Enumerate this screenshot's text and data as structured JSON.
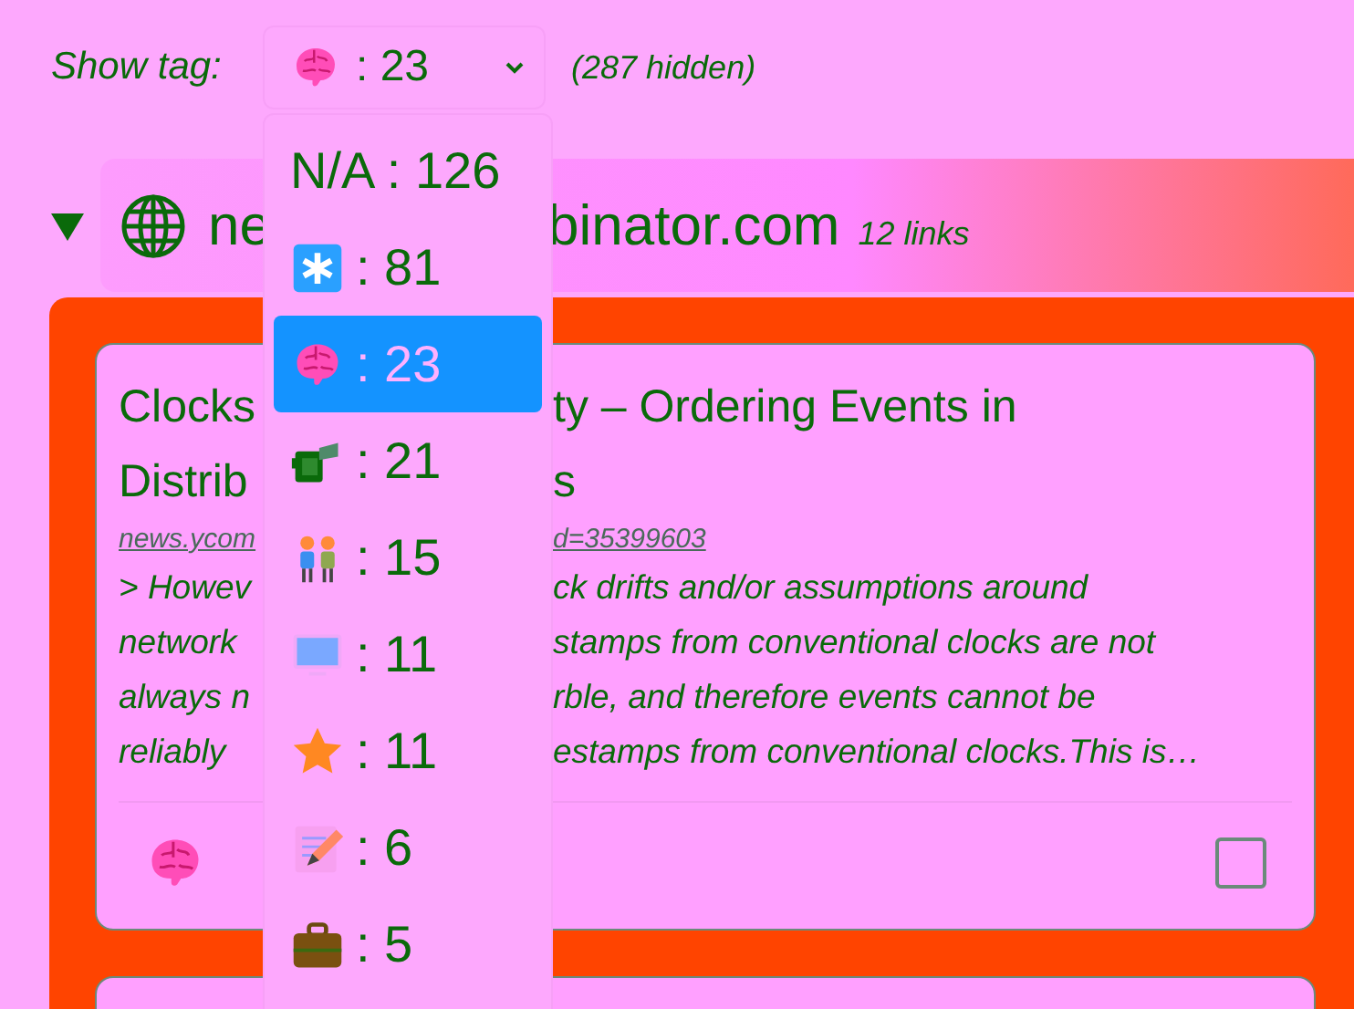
{
  "filter": {
    "label": "Show tag:",
    "selected": {
      "kind": "brain",
      "text": ": 23"
    },
    "hidden_count": "(287 hidden)"
  },
  "dropdown": [
    {
      "kind": "none",
      "text": "N/A : 126",
      "selected": false
    },
    {
      "kind": "asterisk",
      "text": ": 81",
      "selected": false
    },
    {
      "kind": "brain",
      "text": ": 23",
      "selected": true
    },
    {
      "kind": "camera",
      "text": ": 21",
      "selected": false
    },
    {
      "kind": "people",
      "text": ": 15",
      "selected": false
    },
    {
      "kind": "monitor",
      "text": ": 11",
      "selected": false
    },
    {
      "kind": "star",
      "text": ": 11",
      "selected": false
    },
    {
      "kind": "memo",
      "text": ": 6",
      "selected": false
    },
    {
      "kind": "briefcase",
      "text": ": 5",
      "selected": false
    }
  ],
  "group": {
    "expanded": true,
    "domain_left": "ne",
    "domain_right": "binator.com",
    "count": "12 links",
    "card": {
      "title_lines": [
        [
          "Clocks",
          "ty – Ordering Events in"
        ],
        [
          "Distrib",
          "s"
        ]
      ],
      "url": [
        "news.ycom",
        "d=35399603"
      ],
      "description_lines": [
        [
          "> Howev",
          "ck drifts and/or assumptions around"
        ],
        [
          "network",
          "stamps from conventional clocks are not"
        ],
        [
          "always n",
          "rble, and therefore events cannot be"
        ],
        [
          "reliably",
          "estamps from conventional clocks.This is…"
        ]
      ],
      "tag": {
        "kind": "brain"
      },
      "checked": false
    }
  }
}
